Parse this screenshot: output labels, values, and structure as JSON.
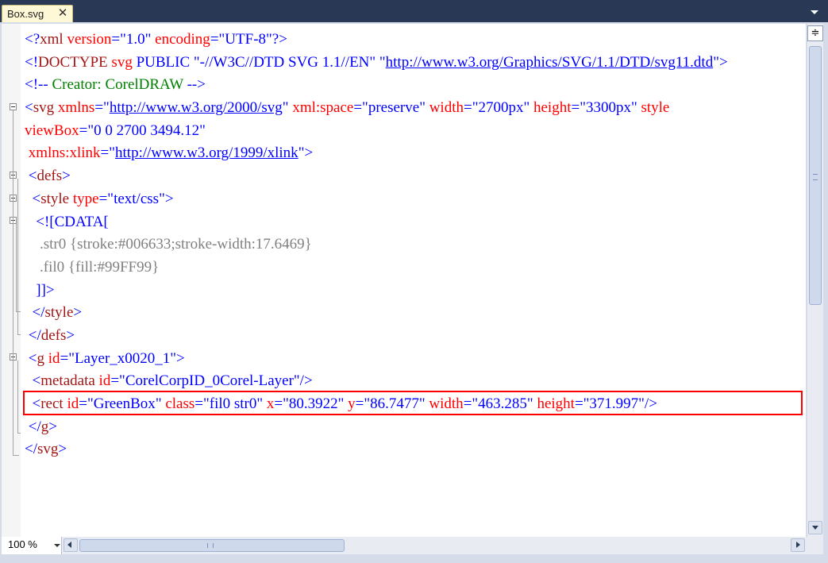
{
  "tab": {
    "title": "Box.svg",
    "close_glyph": "✕"
  },
  "editor": {
    "zoom": "100 %",
    "split_glyph": "≑",
    "lines": [
      [
        [
          "t-punct",
          "<?"
        ],
        [
          "t-tag",
          "xml"
        ],
        [
          "t-punct",
          " "
        ],
        [
          "t-attr",
          "version"
        ],
        [
          "t-punct",
          "=\""
        ],
        [
          "t-val",
          "1.0"
        ],
        [
          "t-punct",
          "\" "
        ],
        [
          "t-attr",
          "encoding"
        ],
        [
          "t-punct",
          "=\""
        ],
        [
          "t-val",
          "UTF-8"
        ],
        [
          "t-punct",
          "\"?>"
        ]
      ],
      [
        [
          "t-punct",
          "<!"
        ],
        [
          "t-tag",
          "DOCTYPE"
        ],
        [
          "t-punct",
          " "
        ],
        [
          "t-attr",
          "svg"
        ],
        [
          "t-punct",
          " PUBLIC \"-//W3C//DTD SVG 1.1//EN\" \""
        ],
        [
          "t-url",
          "http://www.w3.org/Graphics/SVG/1.1/DTD/svg11.dtd"
        ],
        [
          "t-punct",
          "\">"
        ]
      ],
      [
        [
          "t-punct",
          "<!--"
        ],
        [
          "t-comment",
          " Creator: CorelDRAW "
        ],
        [
          "t-punct",
          "-->"
        ]
      ],
      [
        [
          "t-punct",
          "<"
        ],
        [
          "t-tag",
          "svg"
        ],
        [
          "t-punct",
          " "
        ],
        [
          "t-attr",
          "xmlns"
        ],
        [
          "t-punct",
          "=\""
        ],
        [
          "t-url",
          "http://www.w3.org/2000/svg"
        ],
        [
          "t-punct",
          "\" "
        ],
        [
          "t-attr",
          "xml:space"
        ],
        [
          "t-punct",
          "=\""
        ],
        [
          "t-val",
          "preserve"
        ],
        [
          "t-punct",
          "\" "
        ],
        [
          "t-attr",
          "width"
        ],
        [
          "t-punct",
          "=\""
        ],
        [
          "t-val",
          "2700px"
        ],
        [
          "t-punct",
          "\" "
        ],
        [
          "t-attr",
          "height"
        ],
        [
          "t-punct",
          "=\""
        ],
        [
          "t-val",
          "3300px"
        ],
        [
          "t-punct",
          "\" "
        ],
        [
          "t-attr",
          "style"
        ]
      ],
      [
        [
          "t-attr",
          "viewBox"
        ],
        [
          "t-punct",
          "=\""
        ],
        [
          "t-val",
          "0 0 2700 3494.12"
        ],
        [
          "t-punct",
          "\""
        ]
      ],
      [
        [
          "t-punct",
          " "
        ],
        [
          "t-attr",
          "xmlns:xlink"
        ],
        [
          "t-punct",
          "=\""
        ],
        [
          "t-url",
          "http://www.w3.org/1999/xlink"
        ],
        [
          "t-punct",
          "\">"
        ]
      ],
      [
        [
          "t-punct",
          " <"
        ],
        [
          "t-tag",
          "defs"
        ],
        [
          "t-punct",
          ">"
        ]
      ],
      [
        [
          "t-punct",
          "  <"
        ],
        [
          "t-tag",
          "style"
        ],
        [
          "t-punct",
          " "
        ],
        [
          "t-attr",
          "type"
        ],
        [
          "t-punct",
          "=\""
        ],
        [
          "t-val",
          "text/css"
        ],
        [
          "t-punct",
          "\">"
        ]
      ],
      [
        [
          "t-punct",
          "   <![CDATA["
        ]
      ],
      [
        [
          "t-cdata",
          "    .str0 {stroke:#006633;stroke-width:17.6469}"
        ]
      ],
      [
        [
          "t-cdata",
          "    .fil0 {fill:#99FF99}"
        ]
      ],
      [
        [
          "t-punct",
          "   ]]>"
        ]
      ],
      [
        [
          "t-punct",
          "  </"
        ],
        [
          "t-tag",
          "style"
        ],
        [
          "t-punct",
          ">"
        ]
      ],
      [
        [
          "t-punct",
          " </"
        ],
        [
          "t-tag",
          "defs"
        ],
        [
          "t-punct",
          ">"
        ]
      ],
      [
        [
          "t-punct",
          " <"
        ],
        [
          "t-tag",
          "g"
        ],
        [
          "t-punct",
          " "
        ],
        [
          "t-attr",
          "id"
        ],
        [
          "t-punct",
          "=\""
        ],
        [
          "t-val",
          "Layer_x0020_1"
        ],
        [
          "t-punct",
          "\">"
        ]
      ],
      [
        [
          "t-punct",
          "  <"
        ],
        [
          "t-tag",
          "metadata"
        ],
        [
          "t-punct",
          " "
        ],
        [
          "t-attr",
          "id"
        ],
        [
          "t-punct",
          "=\""
        ],
        [
          "t-val",
          "CorelCorpID_0Corel-Layer"
        ],
        [
          "t-punct",
          "\"/>"
        ]
      ],
      [
        [
          "t-punct",
          "  <"
        ],
        [
          "t-tag",
          "rect"
        ],
        [
          "t-punct",
          " "
        ],
        [
          "t-attr",
          "id"
        ],
        [
          "t-punct",
          "=\""
        ],
        [
          "t-val",
          "GreenBox"
        ],
        [
          "t-punct",
          "\" "
        ],
        [
          "t-attr",
          "class"
        ],
        [
          "t-punct",
          "=\""
        ],
        [
          "t-val",
          "fil0 str0"
        ],
        [
          "t-punct",
          "\" "
        ],
        [
          "t-attr",
          "x"
        ],
        [
          "t-punct",
          "=\""
        ],
        [
          "t-val",
          "80.3922"
        ],
        [
          "t-punct",
          "\" "
        ],
        [
          "t-attr",
          "y"
        ],
        [
          "t-punct",
          "=\""
        ],
        [
          "t-val",
          "86.7477"
        ],
        [
          "t-punct",
          "\" "
        ],
        [
          "t-attr",
          "width"
        ],
        [
          "t-punct",
          "=\""
        ],
        [
          "t-val",
          "463.285"
        ],
        [
          "t-punct",
          "\" "
        ],
        [
          "t-attr",
          "height"
        ],
        [
          "t-punct",
          "=\""
        ],
        [
          "t-val",
          "371.997"
        ],
        [
          "t-punct",
          "\"/>"
        ]
      ],
      [
        [
          "t-punct",
          " </"
        ],
        [
          "t-tag",
          "g"
        ],
        [
          "t-punct",
          ">"
        ]
      ],
      [
        [
          "t-punct",
          "</"
        ],
        [
          "t-tag",
          "svg"
        ],
        [
          "t-punct",
          ">"
        ]
      ]
    ]
  }
}
